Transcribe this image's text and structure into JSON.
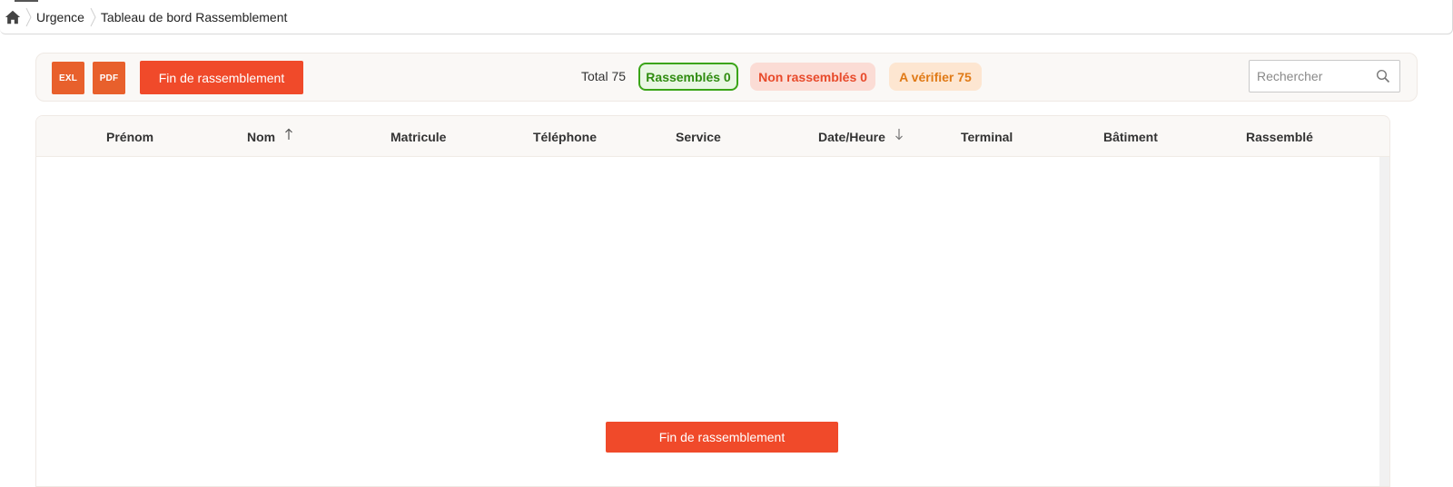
{
  "breadcrumb": {
    "items": [
      "Urgence",
      "Tableau de bord Rassemblement"
    ]
  },
  "toolbar": {
    "excel_label": "EXL",
    "pdf_label": "PDF",
    "fin_label": "Fin de rassemblement",
    "total_label": "Total 75",
    "badges": {
      "rassembles": "Rassemblés 0",
      "non_rassembles": "Non rassemblés 0",
      "a_verifier": "A vérifier 75"
    },
    "search_placeholder": "Rechercher"
  },
  "table": {
    "columns": [
      "Prénom",
      "Nom",
      "Matricule",
      "Téléphone",
      "Service",
      "Date/Heure",
      "Terminal",
      "Bâtiment",
      "Rassemblé"
    ],
    "rows": []
  },
  "footer": {
    "fin_label": "Fin de rassemblement"
  },
  "colors": {
    "accent": "#f04a2a",
    "export": "#e8602c",
    "ok": "#3aa417",
    "non": "#e84a2b",
    "verify": "#e07a16"
  },
  "icons": [
    "home-icon",
    "chevron-right-icon",
    "search-icon",
    "sort-asc-icon",
    "sort-desc-icon"
  ]
}
